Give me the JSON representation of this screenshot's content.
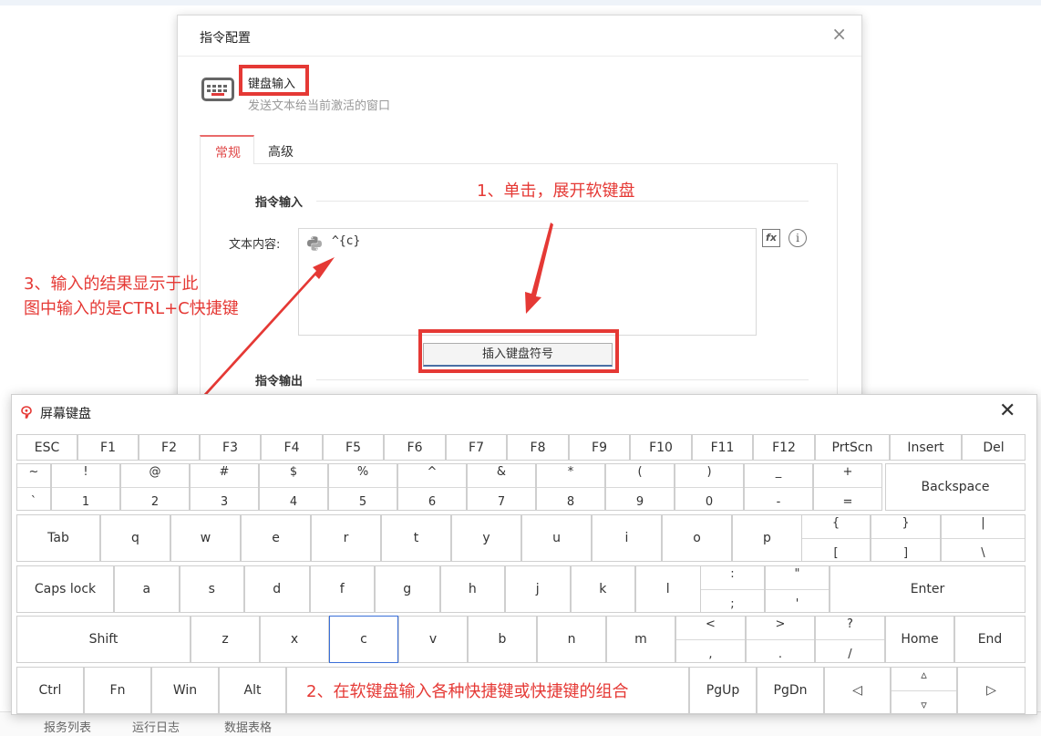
{
  "background_tabs": [
    "报务列表",
    "运行日志",
    "数据表格"
  ],
  "dialog": {
    "title": "指令配置",
    "close": "×",
    "command_name": "键盘输入",
    "command_desc": "发送文本给当前激活的窗口",
    "tabs": [
      "常规",
      "高级"
    ],
    "section_input": "指令输入",
    "text_label": "文本内容:",
    "text_value": "^{c}",
    "fx": "fx",
    "info": "i",
    "insert_button": "插入键盘符号",
    "section_output": "指令输出"
  },
  "annotations": {
    "step1": "1、单击，展开软键盘",
    "step2": "2、在软键盘输入各种快捷键或快捷键的组合",
    "step3_line1": "3、输入的结果显示于此",
    "step3_line2": "图中输入的是CTRL+C快捷键",
    "color": "#e53935"
  },
  "keyboard": {
    "title": "屏幕键盘",
    "close": "✕",
    "fn_row": [
      "ESC",
      "F1",
      "F2",
      "F3",
      "F4",
      "F5",
      "F6",
      "F7",
      "F8",
      "F9",
      "F10",
      "F11",
      "F12",
      "PrtScn",
      "Insert",
      "Del"
    ],
    "num_row": [
      {
        "top": "~",
        "bottom": "`"
      },
      {
        "top": "!",
        "bottom": "1"
      },
      {
        "top": "@",
        "bottom": "2"
      },
      {
        "top": "#",
        "bottom": "3"
      },
      {
        "top": "$",
        "bottom": "4"
      },
      {
        "top": "%",
        "bottom": "5"
      },
      {
        "top": "^",
        "bottom": "6"
      },
      {
        "top": "&",
        "bottom": "7"
      },
      {
        "top": "*",
        "bottom": "8"
      },
      {
        "top": "(",
        "bottom": "9"
      },
      {
        "top": ")",
        "bottom": "0"
      },
      {
        "top": "_",
        "bottom": "-"
      },
      {
        "top": "+",
        "bottom": "="
      }
    ],
    "backspace": "Backspace",
    "tab": "Tab",
    "q_row": [
      "q",
      "w",
      "e",
      "r",
      "t",
      "y",
      "u",
      "i",
      "o",
      "p"
    ],
    "q_row_sym": [
      {
        "top": "{",
        "bottom": "["
      },
      {
        "top": "}",
        "bottom": "]"
      },
      {
        "top": "|",
        "bottom": "\\"
      }
    ],
    "caps": "Caps lock",
    "a_row": [
      "a",
      "s",
      "d",
      "f",
      "g",
      "h",
      "j",
      "k",
      "l"
    ],
    "a_row_sym": [
      {
        "top": ":",
        "bottom": ";"
      },
      {
        "top": "\"",
        "bottom": "'"
      }
    ],
    "enter": "Enter",
    "shift": "Shift",
    "z_row": [
      "z",
      "x",
      "c",
      "v",
      "b",
      "n",
      "m"
    ],
    "z_row_sym": [
      {
        "top": "<",
        "bottom": ","
      },
      {
        "top": ">",
        "bottom": "."
      },
      {
        "top": "?",
        "bottom": "/"
      }
    ],
    "home": "Home",
    "end": "End",
    "bottom_row": [
      "Ctrl",
      "Fn",
      "Win",
      "Alt"
    ],
    "pgup": "PgUp",
    "pgdn": "PgDn",
    "arrow_left": "◁",
    "arrow_up": "▵",
    "arrow_down": "▿",
    "arrow_right": "▷",
    "active_key": "c"
  }
}
